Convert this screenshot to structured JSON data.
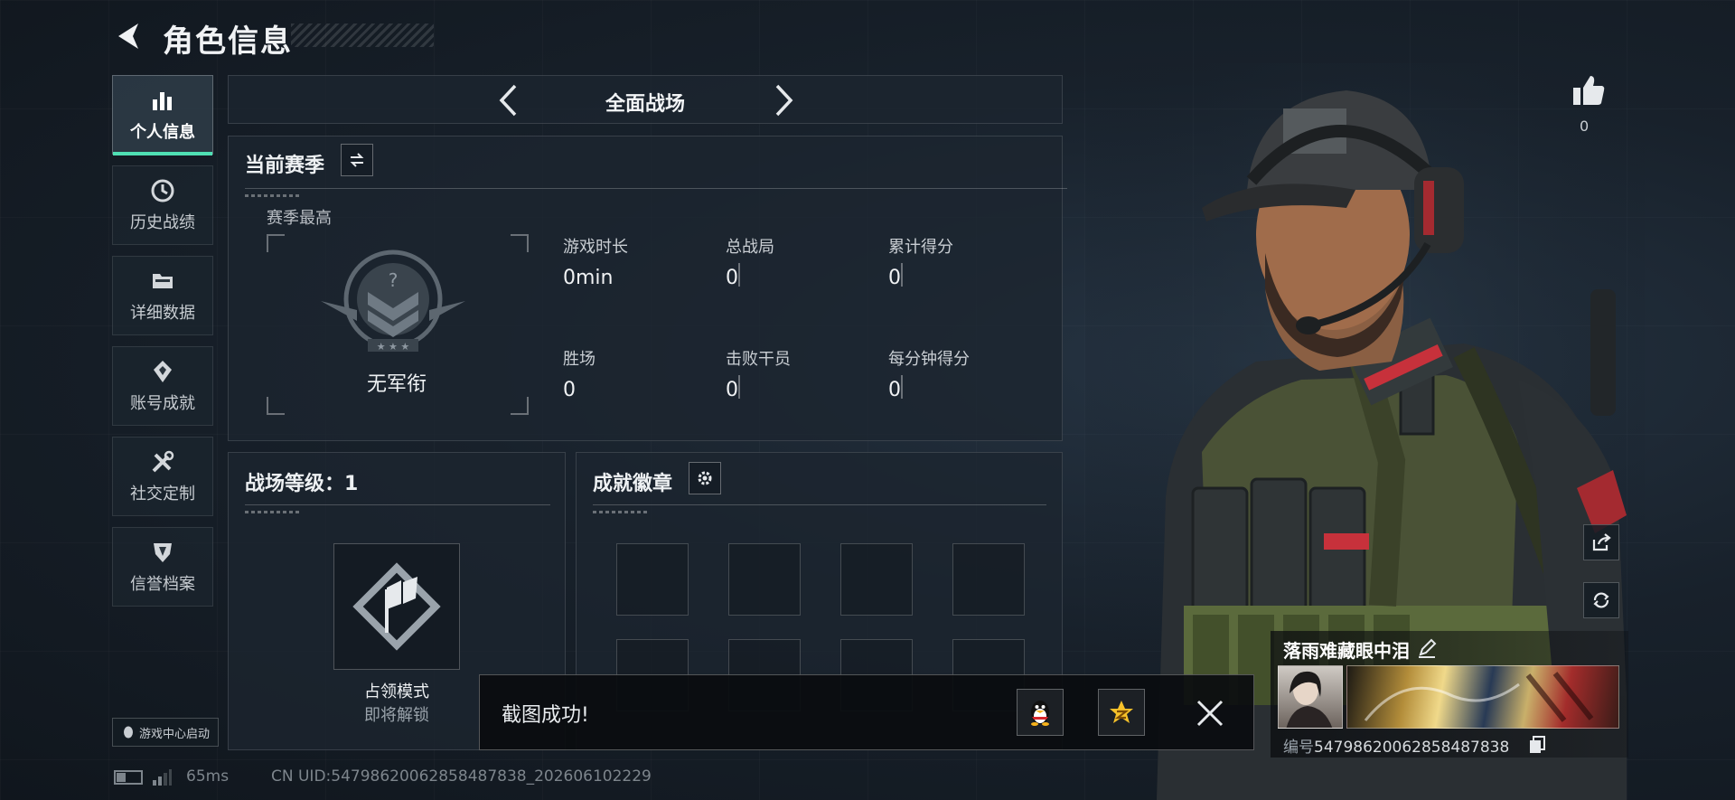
{
  "header": {
    "title": "角色信息"
  },
  "sidebar": {
    "items": [
      {
        "label": "个人信息",
        "icon": "bar-chart-icon",
        "active": true
      },
      {
        "label": "历史战绩",
        "icon": "clock-icon"
      },
      {
        "label": "详细数据",
        "icon": "folder-icon"
      },
      {
        "label": "账号成就",
        "icon": "achievement-icon"
      },
      {
        "label": "社交定制",
        "icon": "tools-icon"
      },
      {
        "label": "信誉档案",
        "icon": "shield-icon"
      }
    ],
    "game_center": "游戏中心启动"
  },
  "mode_selector": {
    "label": "全面战场"
  },
  "season": {
    "title": "当前赛季",
    "best_label": "赛季最高",
    "rank_name": "无军衔",
    "stats": [
      {
        "label": "游戏时长",
        "value": "0min"
      },
      {
        "label": "总战局",
        "value": "0"
      },
      {
        "label": "累计得分",
        "value": "0"
      },
      {
        "label": "胜场",
        "value": "0"
      },
      {
        "label": "击败干员",
        "value": "0"
      },
      {
        "label": "每分钟得分",
        "value": "0"
      }
    ]
  },
  "battlefield_level": {
    "title": "战场等级：1",
    "mode_name": "占领模式",
    "mode_status": "即将解锁"
  },
  "badges": {
    "title": "成就徽章",
    "slots_visible": 8
  },
  "like": {
    "count": "0"
  },
  "profile": {
    "name": "落雨难藏眼中泪",
    "id_label": "编号",
    "id_value": "5479862006285848783​8"
  },
  "toast": {
    "message": "截图成功!"
  },
  "footer": {
    "ping": "65ms",
    "uid_text": "CN UID:547986200628584878​38_202606102229",
    "battery_level": 0.4
  },
  "colors": {
    "accent": "#4fe0b4",
    "background": "#141c25",
    "badge_red": "#c7313b"
  }
}
